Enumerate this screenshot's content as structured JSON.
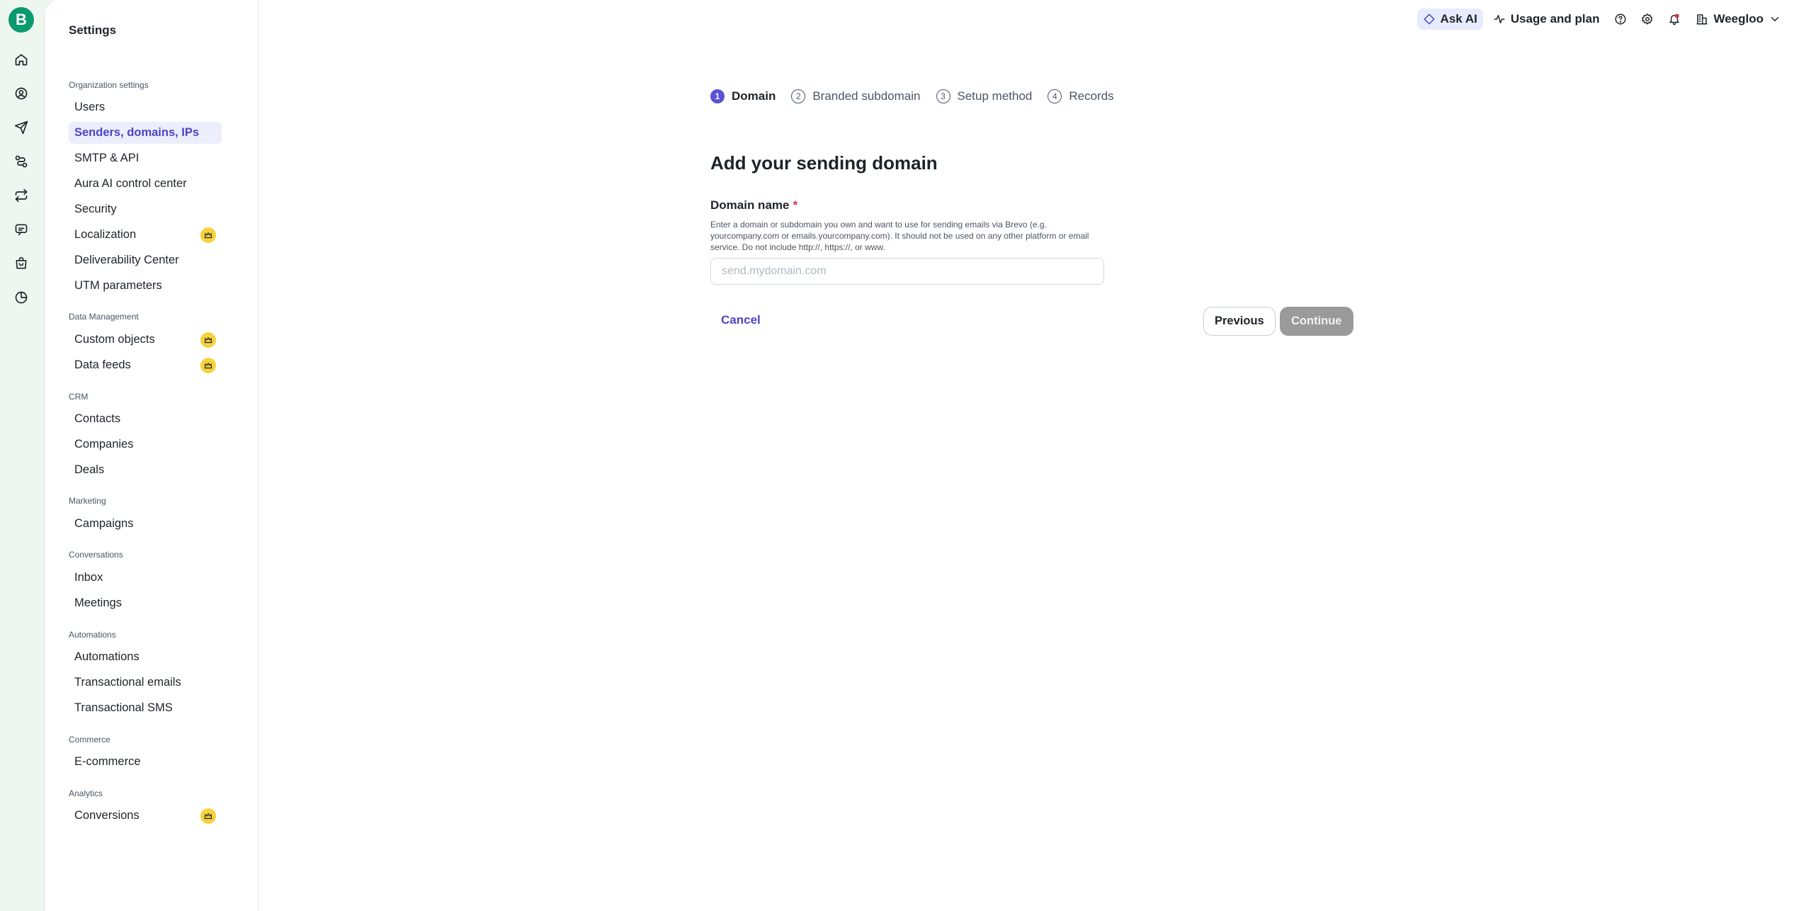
{
  "rail": {
    "logo_letter": "B",
    "icons": [
      "home-icon",
      "contacts-icon",
      "campaigns-icon",
      "automations-icon",
      "conversations-icon",
      "chat-icon",
      "shop-icon",
      "analytics-icon"
    ]
  },
  "settings": {
    "title": "Settings",
    "sections": [
      {
        "label": "Organization settings",
        "items": [
          {
            "label": "Users"
          },
          {
            "label": "Senders, domains, IPs",
            "active": true
          },
          {
            "label": "SMTP & API"
          },
          {
            "label": "Aura AI control center"
          },
          {
            "label": "Security"
          },
          {
            "label": "Localization",
            "premium": true
          },
          {
            "label": "Deliverability Center"
          },
          {
            "label": "UTM parameters"
          }
        ]
      },
      {
        "label": "Data Management",
        "items": [
          {
            "label": "Custom objects",
            "premium": true
          },
          {
            "label": "Data feeds",
            "premium": true
          }
        ]
      },
      {
        "label": "CRM",
        "items": [
          {
            "label": "Contacts"
          },
          {
            "label": "Companies"
          },
          {
            "label": "Deals"
          }
        ]
      },
      {
        "label": "Marketing",
        "items": [
          {
            "label": "Campaigns"
          }
        ]
      },
      {
        "label": "Conversations",
        "items": [
          {
            "label": "Inbox"
          },
          {
            "label": "Meetings"
          }
        ]
      },
      {
        "label": "Automations",
        "items": [
          {
            "label": "Automations"
          },
          {
            "label": "Transactional emails"
          },
          {
            "label": "Transactional SMS"
          }
        ]
      },
      {
        "label": "Commerce",
        "items": [
          {
            "label": "E-commerce"
          }
        ]
      },
      {
        "label": "Analytics",
        "items": [
          {
            "label": "Conversions",
            "premium": true
          }
        ]
      }
    ]
  },
  "topbar": {
    "ask_ai": "Ask AI",
    "usage": "Usage and plan",
    "account": "Weegloo"
  },
  "stepper": {
    "steps": [
      {
        "num": "1",
        "label": "Domain",
        "current": true
      },
      {
        "num": "2",
        "label": "Branded subdomain"
      },
      {
        "num": "3",
        "label": "Setup method"
      },
      {
        "num": "4",
        "label": "Records"
      }
    ]
  },
  "form": {
    "title": "Add your sending domain",
    "field_label": "Domain name",
    "required_mark": "*",
    "help": "Enter a domain or subdomain you own and want to use for sending emails via Brevo (e.g. yourcompany.com or emails.yourcompany.com). It should not be used on any other platform or email service. Do not include http://, https://, or www.",
    "placeholder": "send.mydomain.com",
    "value": "",
    "cancel": "Cancel",
    "previous": "Previous",
    "continue": "Continue"
  },
  "colors": {
    "accent": "#5b52d8",
    "brand": "#0b996e",
    "premium": "#f6d23d",
    "disabled": "#9a9a9a"
  }
}
